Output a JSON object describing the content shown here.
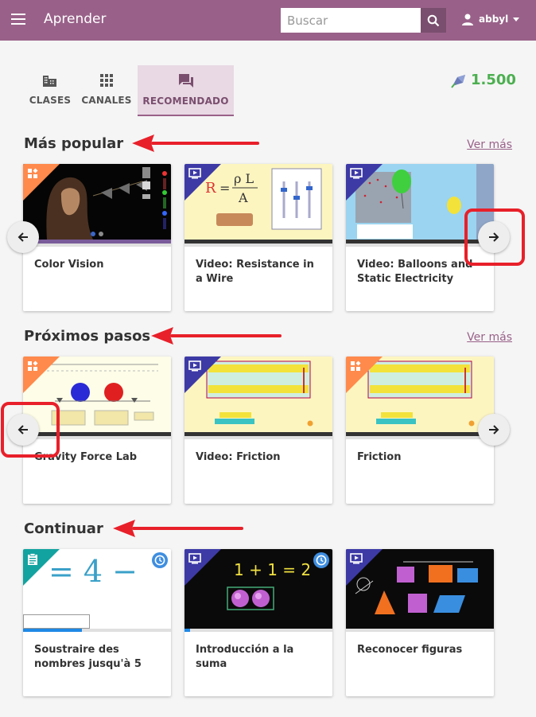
{
  "appbar": {
    "title": "Aprender",
    "search_placeholder": "Buscar",
    "username": "abbyl"
  },
  "tabs": [
    {
      "label": "CLASES",
      "icon": "classes-icon",
      "active": false
    },
    {
      "label": "CANALES",
      "icon": "channels-icon",
      "active": false
    },
    {
      "label": "RECOMENDADO",
      "icon": "recommended-icon",
      "active": true
    }
  ],
  "points": "1.500",
  "sections": {
    "popular": {
      "title": "Más popular",
      "see_more": "Ver más",
      "cards": [
        {
          "title": "Color Vision",
          "kind": "simulation"
        },
        {
          "title": "Video: Resistance in a Wire",
          "kind": "video"
        },
        {
          "title": "Video: Balloons and Static Electricity",
          "kind": "video"
        }
      ]
    },
    "next_steps": {
      "title": "Próximos pasos",
      "see_more": "Ver más",
      "cards": [
        {
          "title": "Gravity Force Lab",
          "kind": "simulation"
        },
        {
          "title": "Video: Friction",
          "kind": "video"
        },
        {
          "title": "Friction",
          "kind": "simulation"
        }
      ]
    },
    "continue": {
      "title": "Continuar",
      "cards": [
        {
          "title": "Soustraire des nombres jusqu'à 5",
          "kind": "exercise",
          "progress": 0.1
        },
        {
          "title": "Introducción a la suma",
          "kind": "video",
          "progress": 0.04
        },
        {
          "title": "Reconocer figuras",
          "kind": "video",
          "progress": 0
        }
      ],
      "thumb_texts": {
        "subtraction": "= 4 −",
        "addition": "1 + 1 = 2"
      }
    }
  },
  "colors": {
    "brand": "#996189",
    "points": "#4caf50",
    "simulation": "#ff8a4c",
    "video": "#3d3aa6",
    "exercise": "#12a3a0",
    "annotation": "#e8202a"
  }
}
